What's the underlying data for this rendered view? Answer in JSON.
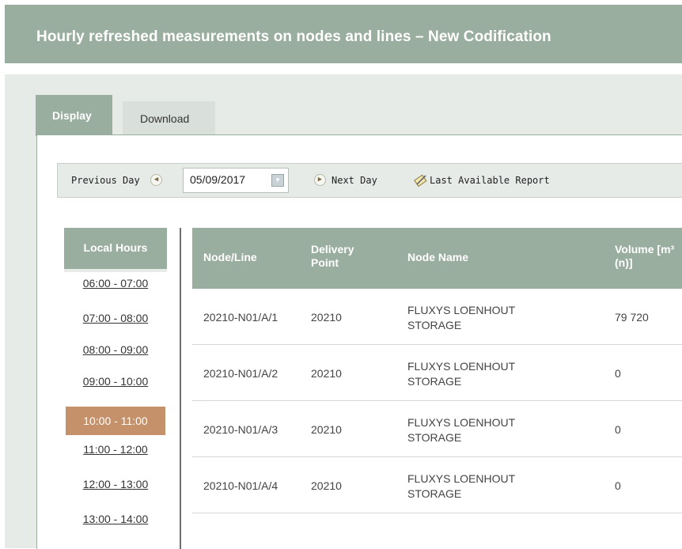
{
  "header": {
    "title": "Hourly refreshed measurements on nodes and lines – New Codification"
  },
  "tabs": [
    {
      "label": "Display",
      "active": true
    },
    {
      "label": "Download",
      "active": false
    }
  ],
  "toolbar": {
    "previous_label": "Previous Day",
    "date_value": "05/09/2017",
    "next_label": "Next Day",
    "last_label": "Last Available Report"
  },
  "hours": {
    "header": "Local Hours",
    "items": [
      "06:00 - 07:00",
      "07:00 - 08:00",
      "08:00 - 09:00",
      "09:00 - 10:00",
      "10:00 - 11:00",
      "11:00 - 12:00",
      "12:00 - 13:00",
      "13:00 - 14:00"
    ],
    "selected": "10:00 - 11:00"
  },
  "table": {
    "columns": [
      "Node/Line",
      "Delivery Point",
      "Node Name",
      "Volume [m³(n)]"
    ],
    "col_node": "Node/Line",
    "col_dp_1": "Delivery",
    "col_dp_2": "Point",
    "col_name": "Node Name",
    "col_vol_1": "Volume [m³",
    "col_vol_2": "(n)]",
    "rows": [
      {
        "node": "20210-N01/A/1",
        "dp": "20210",
        "name_1": "FLUXYS LOENHOUT",
        "name_2": "STORAGE",
        "volume": "79 720"
      },
      {
        "node": "20210-N01/A/2",
        "dp": "20210",
        "name_1": "FLUXYS LOENHOUT",
        "name_2": "STORAGE",
        "volume": "0"
      },
      {
        "node": "20210-N01/A/3",
        "dp": "20210",
        "name_1": "FLUXYS LOENHOUT",
        "name_2": "STORAGE",
        "volume": "0"
      },
      {
        "node": "20210-N01/A/4",
        "dp": "20210",
        "name_1": "FLUXYS LOENHOUT",
        "name_2": "STORAGE",
        "volume": "0"
      }
    ]
  },
  "colors": {
    "header_bg": "#9aaea0",
    "panel_bg": "#e6ebe8",
    "selected_hour": "#c4916a"
  },
  "icons": {
    "prev": "chevron-left-icon",
    "next": "chevron-right-icon",
    "calendar": "calendar-dropdown-icon",
    "last_report": "report-pencil-icon"
  }
}
